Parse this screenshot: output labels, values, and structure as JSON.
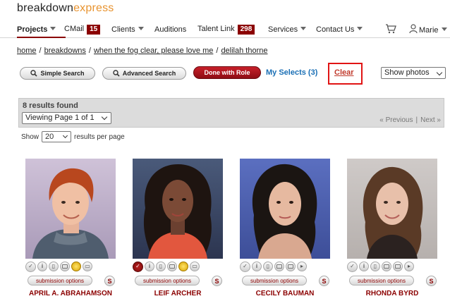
{
  "logo": {
    "part1": "breakdown",
    "part2": "express"
  },
  "nav": {
    "items": [
      {
        "label": "Projects",
        "active": true,
        "caret": true
      },
      {
        "label": "CMail",
        "badge": "15"
      },
      {
        "label": "Clients",
        "caret": true
      },
      {
        "label": "Auditions"
      },
      {
        "label": "Talent Link",
        "badge": "298"
      },
      {
        "label": "Services",
        "caret": true
      },
      {
        "label": "Contact Us",
        "caret": true
      }
    ],
    "cart_icon": "cart-icon",
    "user": {
      "icon": "user-icon",
      "name": "Marie"
    }
  },
  "breadcrumb": [
    "home",
    "breakdowns",
    "when the fog clear, please love me",
    "delilah thorne"
  ],
  "toolbar": {
    "simple_search": "Simple Search",
    "advanced_search": "Advanced Search",
    "done_with_role": "Done with Role",
    "my_selects": "My Selects (3)",
    "clear": "Clear",
    "view_select": "Show photos"
  },
  "results": {
    "count_text": "8 results found",
    "page_select": "Viewing Page 1 of 1",
    "previous": "« Previous",
    "next": "Next »",
    "show_label": "Show",
    "per_page": "20",
    "per_page_label": "results per page"
  },
  "talent": [
    {
      "name": "APRIL A. ABRAHAMSON",
      "selected": false,
      "folder": true,
      "submission": "submission options",
      "s": "S"
    },
    {
      "name": "LEIF ARCHER",
      "selected": true,
      "folder": true,
      "submission": "submission options",
      "s": "S"
    },
    {
      "name": "CECILY BAUMAN",
      "selected": false,
      "folder": false,
      "submission": "submission options",
      "s": "S"
    },
    {
      "name": "RHONDA BYRD",
      "selected": false,
      "folder": false,
      "submission": "submission options",
      "s": "S"
    }
  ],
  "colors": {
    "brand_red": "#8b0000",
    "accent_orange": "#e8932f",
    "link_blue": "#1a6fb5",
    "highlight_box": "#e11414"
  }
}
